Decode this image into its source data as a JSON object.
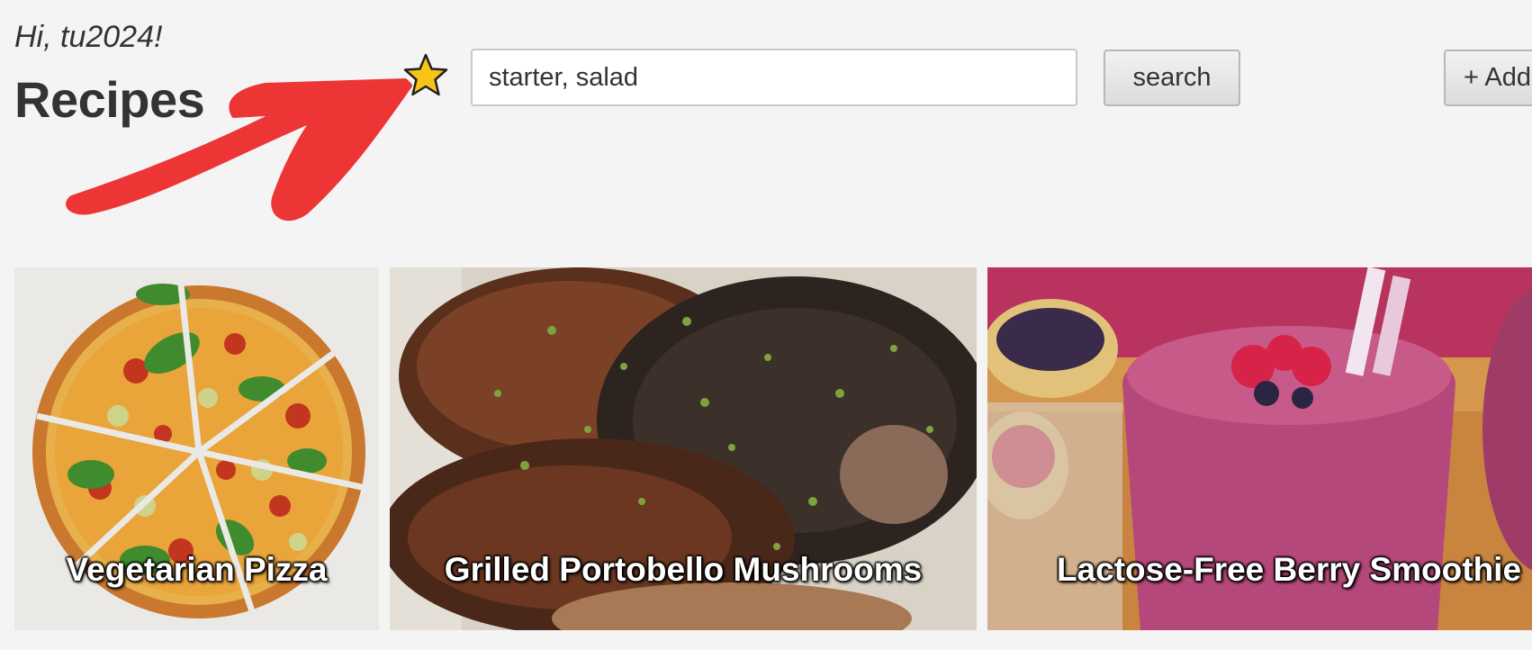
{
  "header": {
    "greeting": "Hi, tu2024!",
    "title": "Recipes"
  },
  "search": {
    "value": "starter, salad",
    "button_label": "search"
  },
  "toolbar": {
    "add_label": "+ Add",
    "favorites_icon": "star-icon"
  },
  "annotation": {
    "icon": "arrow-icon",
    "color": "#ee3536"
  },
  "recipes": [
    {
      "title": "Vegetarian Pizza"
    },
    {
      "title": "Grilled Portobello Mushrooms"
    },
    {
      "title": "Lactose-Free Berry Smoothie"
    }
  ],
  "colors": {
    "background": "#f4f4f4",
    "star_fill": "#f7c418",
    "text": "#333333"
  }
}
